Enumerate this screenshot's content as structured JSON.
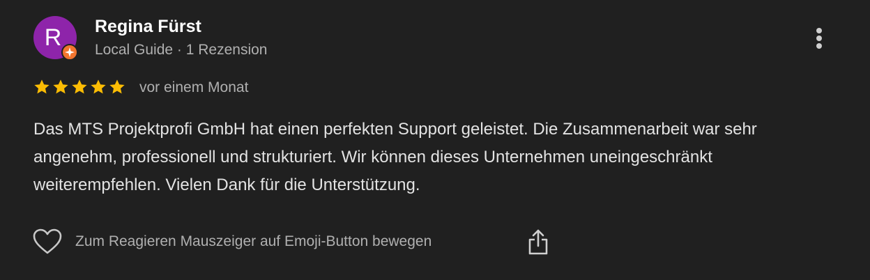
{
  "review": {
    "author": {
      "initial": "R",
      "name": "Regina Fürst",
      "meta": "Local Guide · 1 Rezension",
      "avatar_color": "#8e24aa",
      "badge_color": "#f2752f",
      "badge_icon": "local-guide-badge-icon"
    },
    "rating": {
      "stars": 5,
      "max": 5,
      "star_color": "#fbbc04"
    },
    "date": "vor einem Monat",
    "text": "Das MTS Projektprofi GmbH hat einen perfekten Support geleistet. Die Zusammenarbeit war sehr angenehm, professionell und strukturiert. Wir können dieses Unternehmen uneingeschränkt weiterempfehlen. Vielen Dank für die Unterstützung.",
    "actions": {
      "like_icon": "heart-outline-icon",
      "react_hint": "Zum Reagieren Mauszeiger auf Emoji-Button bewegen",
      "share_icon": "share-icon",
      "more_icon": "more-vertical-icon"
    }
  }
}
